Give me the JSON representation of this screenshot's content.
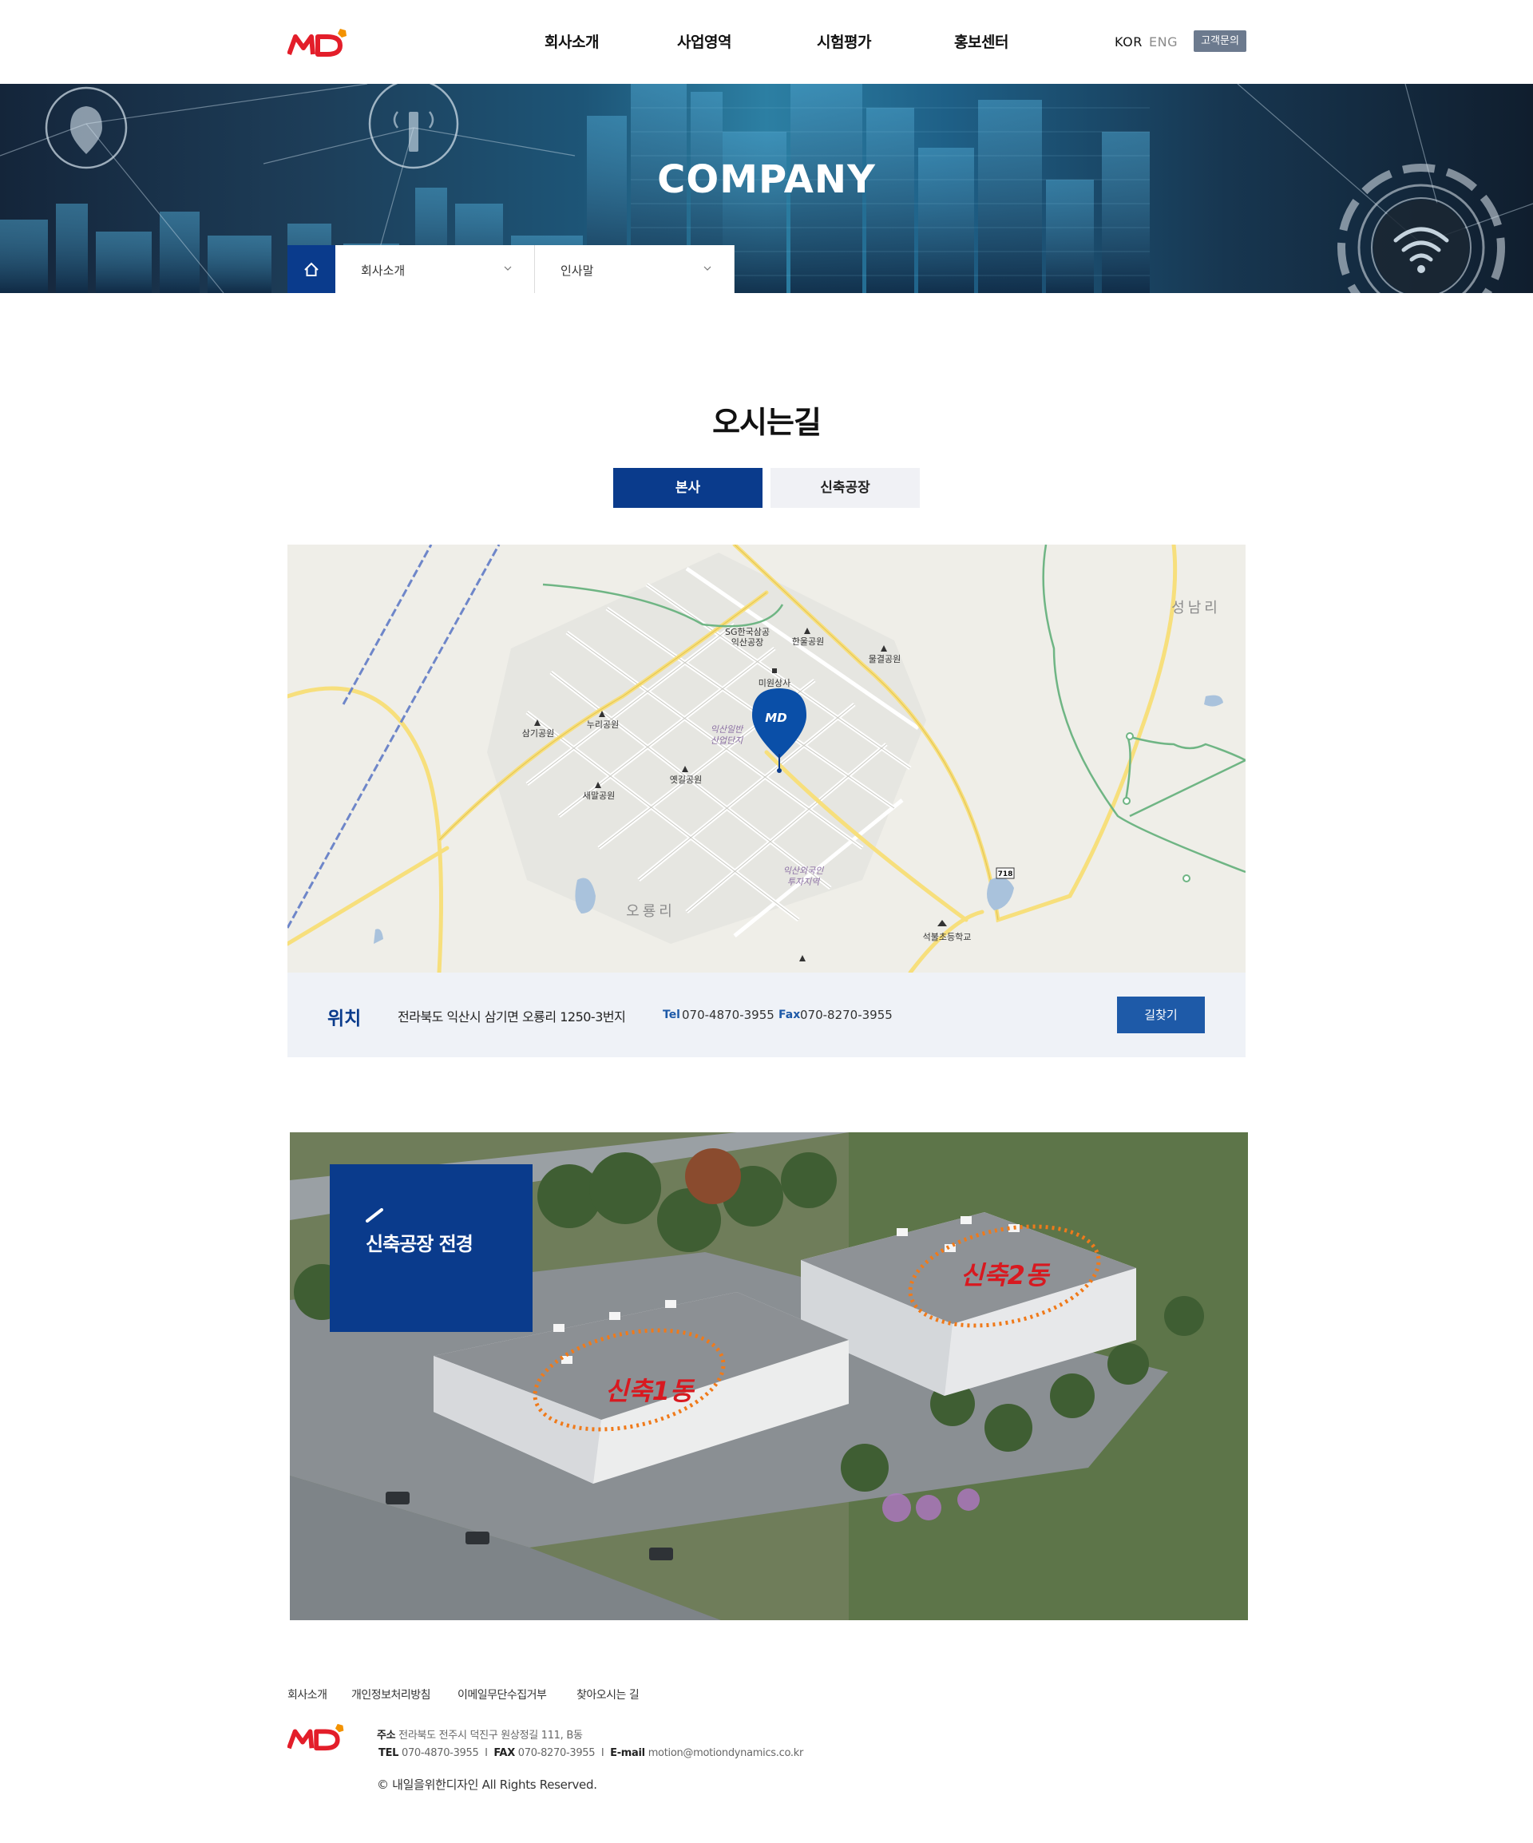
{
  "header": {
    "logo_text": "MD",
    "nav": [
      "회사소개",
      "사업영역",
      "시험평가",
      "홍보센터"
    ],
    "lang_kor": "KOR",
    "lang_eng": "ENG",
    "cs_button": "고객문의"
  },
  "hero": {
    "title": "COMPANY",
    "breadcrumb": {
      "level1": "회사소개",
      "level2": "인사말"
    }
  },
  "main": {
    "title": "오시는길",
    "tabs": [
      {
        "label": "본사",
        "active": true
      },
      {
        "label": "신축공장",
        "active": false
      }
    ],
    "map": {
      "labels": {
        "seongnam": "성남리",
        "sg_factory_1": "SG한국삼공",
        "sg_factory_2": "익산공장",
        "hanul_park": "한울공원",
        "mulgyeol_park": "물결공원",
        "miwon": "미원상사",
        "samgi_park": "삼기공원",
        "nuri_park": "누리공원",
        "ind_complex_1": "익산일반",
        "ind_complex_2": "산업단지",
        "yetgil_park": "옛길공원",
        "saemal_park": "새말공원",
        "foreign_zone_1": "익산외국인",
        "foreign_zone_2": "투자지역",
        "oryong": "오룡리",
        "seokbul_school": "석불초등학교",
        "road_718": "718",
        "marker_logo": "MD"
      }
    },
    "location": {
      "label": "위치",
      "address": "전라북도 익산시 삼기면 오룡리 1250-3번지",
      "tel_label": "Tel",
      "tel": "070-4870-3955",
      "fax_label": "Fax",
      "fax": "070-8270-3955",
      "route_button": "길찾기"
    },
    "factory": {
      "title": "신축공장 전경",
      "building1": "신축1동",
      "building2": "신축2동"
    }
  },
  "footer": {
    "links": [
      "회사소개",
      "개인정보처리방침",
      "이메일무단수집거부",
      "찾아오시는 길"
    ],
    "logo_text": "MD",
    "addr_label": "주소",
    "addr": "전라북도 전주시 덕진구 원상정길 111, B동",
    "tel_label": "TEL",
    "tel": "070-4870-3955",
    "fax_label": "FAX",
    "fax": "070-8270-3955",
    "email_label": "E-mail",
    "email": "motion@motiondynamics.co.kr",
    "copyright": "© 내일을위한디자인  All Rights Reserved."
  },
  "colors": {
    "primary": "#0a3b8c",
    "accent_blue": "#1e5aa8",
    "logo_red": "#e31e2a",
    "logo_orange": "#f39200"
  }
}
